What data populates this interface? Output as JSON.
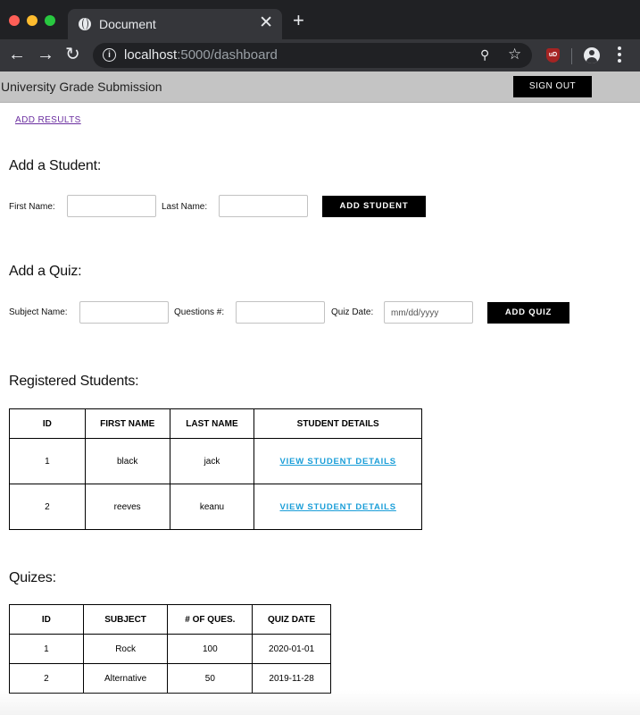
{
  "browser": {
    "tab_title": "Document",
    "tab_close": "✕",
    "new_tab": "+",
    "url_host": "localhost",
    "url_path": ":5000/dashboard",
    "extension_badge": "uD"
  },
  "header": {
    "title": "University Grade Submission",
    "sign_out_label": "SIGN OUT"
  },
  "nav": {
    "add_results_link": "ADD RESULTS"
  },
  "add_student": {
    "heading": "Add a Student:",
    "first_name_label": "First Name:",
    "last_name_label": "Last Name:",
    "first_name_value": "",
    "last_name_value": "",
    "button_label": "ADD STUDENT"
  },
  "add_quiz": {
    "heading": "Add a Quiz:",
    "subject_label": "Subject Name:",
    "questions_label": "Questions #:",
    "date_label": "Quiz Date:",
    "date_placeholder": "mm/dd/yyyy",
    "button_label": "ADD QUIZ"
  },
  "students": {
    "heading": "Registered Students:",
    "columns": [
      "ID",
      "FIRST NAME",
      "LAST NAME",
      "STUDENT DETAILS"
    ],
    "rows": [
      {
        "id": "1",
        "first_name": "black",
        "last_name": "jack",
        "details_link": "VIEW STUDENT DETAILS"
      },
      {
        "id": "2",
        "first_name": "reeves",
        "last_name": "keanu",
        "details_link": "VIEW STUDENT DETAILS"
      }
    ]
  },
  "quizzes": {
    "heading": "Quizes:",
    "columns": [
      "ID",
      "SUBJECT",
      "# OF QUES.",
      "QUIZ DATE"
    ],
    "rows": [
      {
        "id": "1",
        "subject": "Rock",
        "questions": "100",
        "date": "2020-01-01"
      },
      {
        "id": "2",
        "subject": "Alternative",
        "questions": "50",
        "date": "2019-11-28"
      }
    ]
  },
  "colors": {
    "header_bg": "#c4c4c4",
    "link_purple": "#6b2fa0",
    "link_blue": "#1a9ed8",
    "button_bg": "#000000"
  }
}
